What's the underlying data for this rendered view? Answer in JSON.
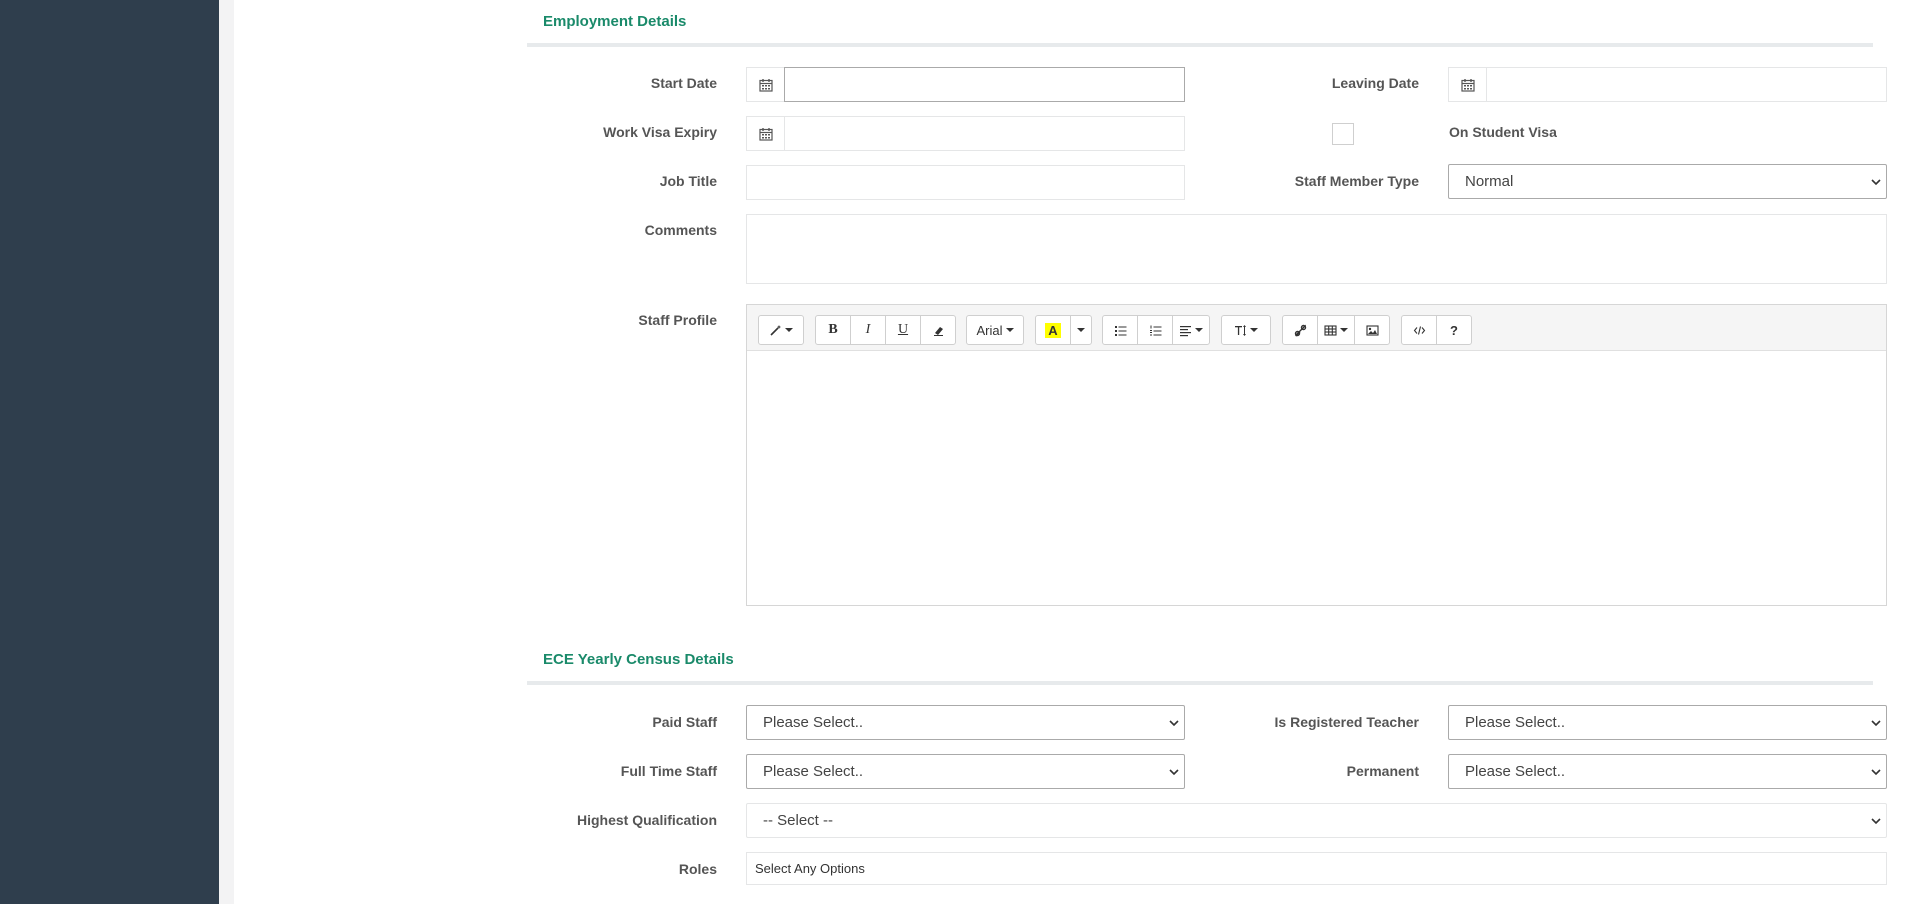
{
  "employment": {
    "title": "Employment Details",
    "start_date_label": "Start Date",
    "leaving_date_label": "Leaving Date",
    "work_visa_label": "Work Visa Expiry",
    "student_visa_label": "On Student Visa",
    "job_title_label": "Job Title",
    "staff_type_label": "Staff Member Type",
    "staff_type_value": "Normal",
    "comments_label": "Comments",
    "staff_profile_label": "Staff Profile"
  },
  "editor": {
    "font_name": "Arial",
    "bold": "B",
    "italic": "I",
    "underline": "U",
    "help": "?",
    "highlight_color": "#ffff00"
  },
  "census": {
    "title": "ECE Yearly Census Details",
    "paid_staff_label": "Paid Staff",
    "paid_staff_value": "Please Select..",
    "registered_teacher_label": "Is Registered Teacher",
    "registered_teacher_value": "Please Select..",
    "full_time_label": "Full Time Staff",
    "full_time_value": "Please Select..",
    "permanent_label": "Permanent",
    "permanent_value": "Please Select..",
    "qualification_label": "Highest Qualification",
    "qualification_value": "-- Select --",
    "roles_label": "Roles",
    "roles_placeholder": "Select Any Options"
  },
  "colors": {
    "sidebar": "#2f3e4d",
    "accent": "#1a8a6a"
  }
}
